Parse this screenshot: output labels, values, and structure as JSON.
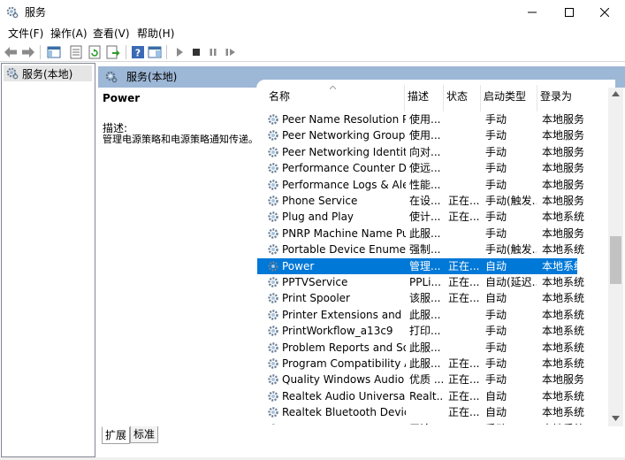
{
  "window": {
    "title": "服务"
  },
  "menu": [
    "文件(F)",
    "操作(A)",
    "查看(V)",
    "帮助(H)"
  ],
  "tree": {
    "root_label": "服务(本地)"
  },
  "pane": {
    "header_title": "服务(本地)",
    "selected_service_name": "Power",
    "description_label": "描述:",
    "description_text": "管理电源策略和电源策略通知传递。"
  },
  "columns": [
    "名称",
    "描述",
    "状态",
    "启动类型",
    "登录为"
  ],
  "rows": [
    {
      "name": "Peer Name Resolution Pro...",
      "desc": "使用...",
      "status": "",
      "startup": "手动",
      "logon": "本地服务"
    },
    {
      "name": "Peer Networking Grouping",
      "desc": "使用...",
      "status": "",
      "startup": "手动",
      "logon": "本地服务"
    },
    {
      "name": "Peer Networking Identity ...",
      "desc": "向对...",
      "status": "",
      "startup": "手动",
      "logon": "本地服务"
    },
    {
      "name": "Performance Counter DLL ...",
      "desc": "使远...",
      "status": "",
      "startup": "手动",
      "logon": "本地服务"
    },
    {
      "name": "Performance Logs & Alerts",
      "desc": "性能...",
      "status": "",
      "startup": "手动",
      "logon": "本地服务"
    },
    {
      "name": "Phone Service",
      "desc": "在设...",
      "status": "正在...",
      "startup": "手动(触发...",
      "logon": "本地服务"
    },
    {
      "name": "Plug and Play",
      "desc": "使计...",
      "status": "正在...",
      "startup": "手动",
      "logon": "本地系统"
    },
    {
      "name": "PNRP Machine Name Publ...",
      "desc": "此服...",
      "status": "",
      "startup": "手动",
      "logon": "本地服务"
    },
    {
      "name": "Portable Device Enumerat...",
      "desc": "强制...",
      "status": "",
      "startup": "手动(触发...",
      "logon": "本地系统"
    },
    {
      "name": "Power",
      "desc": "管理...",
      "status": "正在...",
      "startup": "自动",
      "logon": "本地系统"
    },
    {
      "name": "PPTVService",
      "desc": "PPLi...",
      "status": "正在...",
      "startup": "自动(延迟...",
      "logon": "本地系统"
    },
    {
      "name": "Print Spooler",
      "desc": "该服...",
      "status": "正在...",
      "startup": "自动",
      "logon": "本地系统"
    },
    {
      "name": "Printer Extensions and Noti...",
      "desc": "此服...",
      "status": "",
      "startup": "手动",
      "logon": "本地系统"
    },
    {
      "name": "PrintWorkflow_a13c9",
      "desc": "打印...",
      "status": "",
      "startup": "手动",
      "logon": "本地系统"
    },
    {
      "name": "Problem Reports and Solut...",
      "desc": "此服...",
      "status": "",
      "startup": "手动",
      "logon": "本地系统"
    },
    {
      "name": "Program Compatibility Assi...",
      "desc": "此服...",
      "status": "正在...",
      "startup": "手动",
      "logon": "本地系统"
    },
    {
      "name": "Quality Windows Audio Vi...",
      "desc": "优质 ...",
      "status": "正在...",
      "startup": "手动",
      "logon": "本地服务"
    },
    {
      "name": "Realtek Audio Universal Se...",
      "desc": "Realt...",
      "status": "正在...",
      "startup": "自动",
      "logon": "本地系统"
    },
    {
      "name": "Realtek Bluetooth Device ...",
      "desc": "",
      "status": "正在...",
      "startup": "自动",
      "logon": "本地系统"
    },
    {
      "name": "Remote Access Auto Conn...",
      "desc": "无论...",
      "status": "",
      "startup": "手动",
      "logon": "本地系统"
    }
  ],
  "selected_row_index": 9,
  "tabs": [
    "扩展",
    "标准"
  ],
  "colors": {
    "selection": "#0078d7",
    "pane_header": "#9db7d6"
  }
}
